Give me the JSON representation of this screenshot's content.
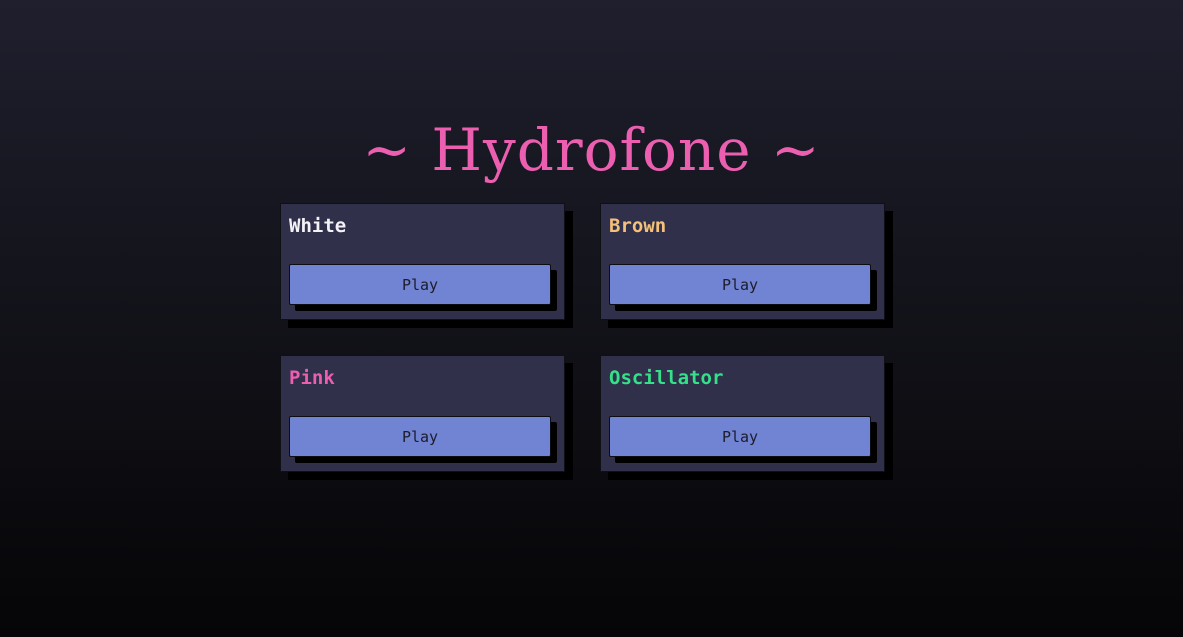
{
  "header": {
    "title": "~ Hydrofone ~"
  },
  "colors": {
    "title": "#ec5fb0",
    "card_bg": "#30304a",
    "button_bg": "#7183d3"
  },
  "cards": [
    {
      "name": "White",
      "color": "#f2f2f7",
      "button_label": "Play"
    },
    {
      "name": "Brown",
      "color": "#f5c07a",
      "button_label": "Play"
    },
    {
      "name": "Pink",
      "color": "#ec5fb0",
      "button_label": "Play"
    },
    {
      "name": "Oscillator",
      "color": "#35e08a",
      "button_label": "Play"
    }
  ]
}
